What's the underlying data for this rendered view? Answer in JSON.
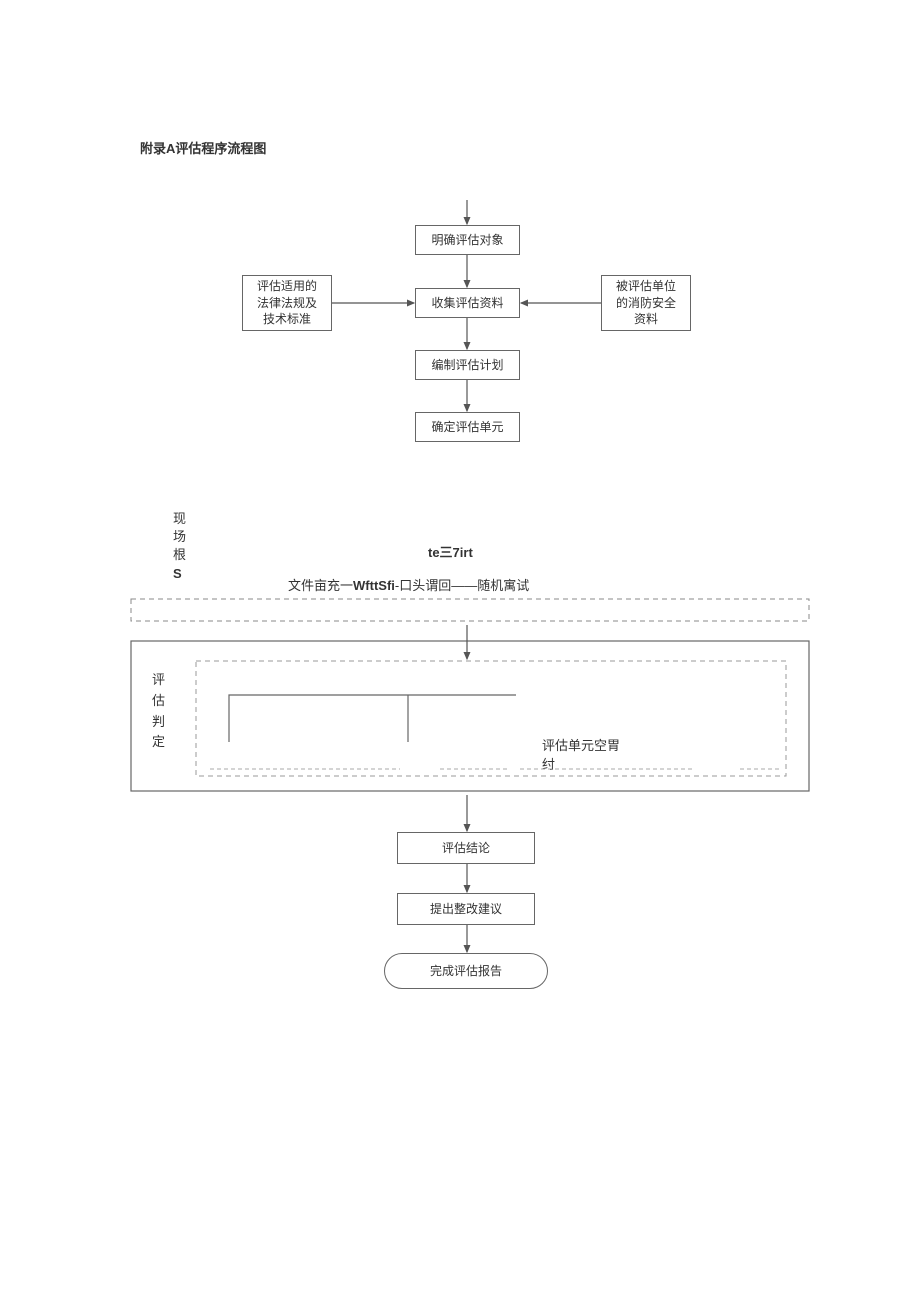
{
  "title": "附录A评估程序流程图",
  "boxes": {
    "b1": "明确评估对象",
    "b2": "评估适用的\n法律法规及\n技术标准",
    "b3": "收集评估资料",
    "b4": "被评估单位\n的消防安全\n资料",
    "b5": "编制评估计划",
    "b6": "确定评估单元",
    "b7": "评估结论",
    "b8": "提出整改建议",
    "b9": "完成评估报告"
  },
  "labels": {
    "left1a": "现",
    "left1b": "场",
    "left1c": "根",
    "left1d": "S",
    "mid1": "te三7irt",
    "mid2a": "文件亩充一",
    "mid2b": "WfttSfi",
    "mid2c": "-口头谓回——随机寓试",
    "left2a": "评",
    "left2b": "估",
    "left2c": "判",
    "left2d": "定",
    "right1": "评估单元空胃\n纣"
  }
}
